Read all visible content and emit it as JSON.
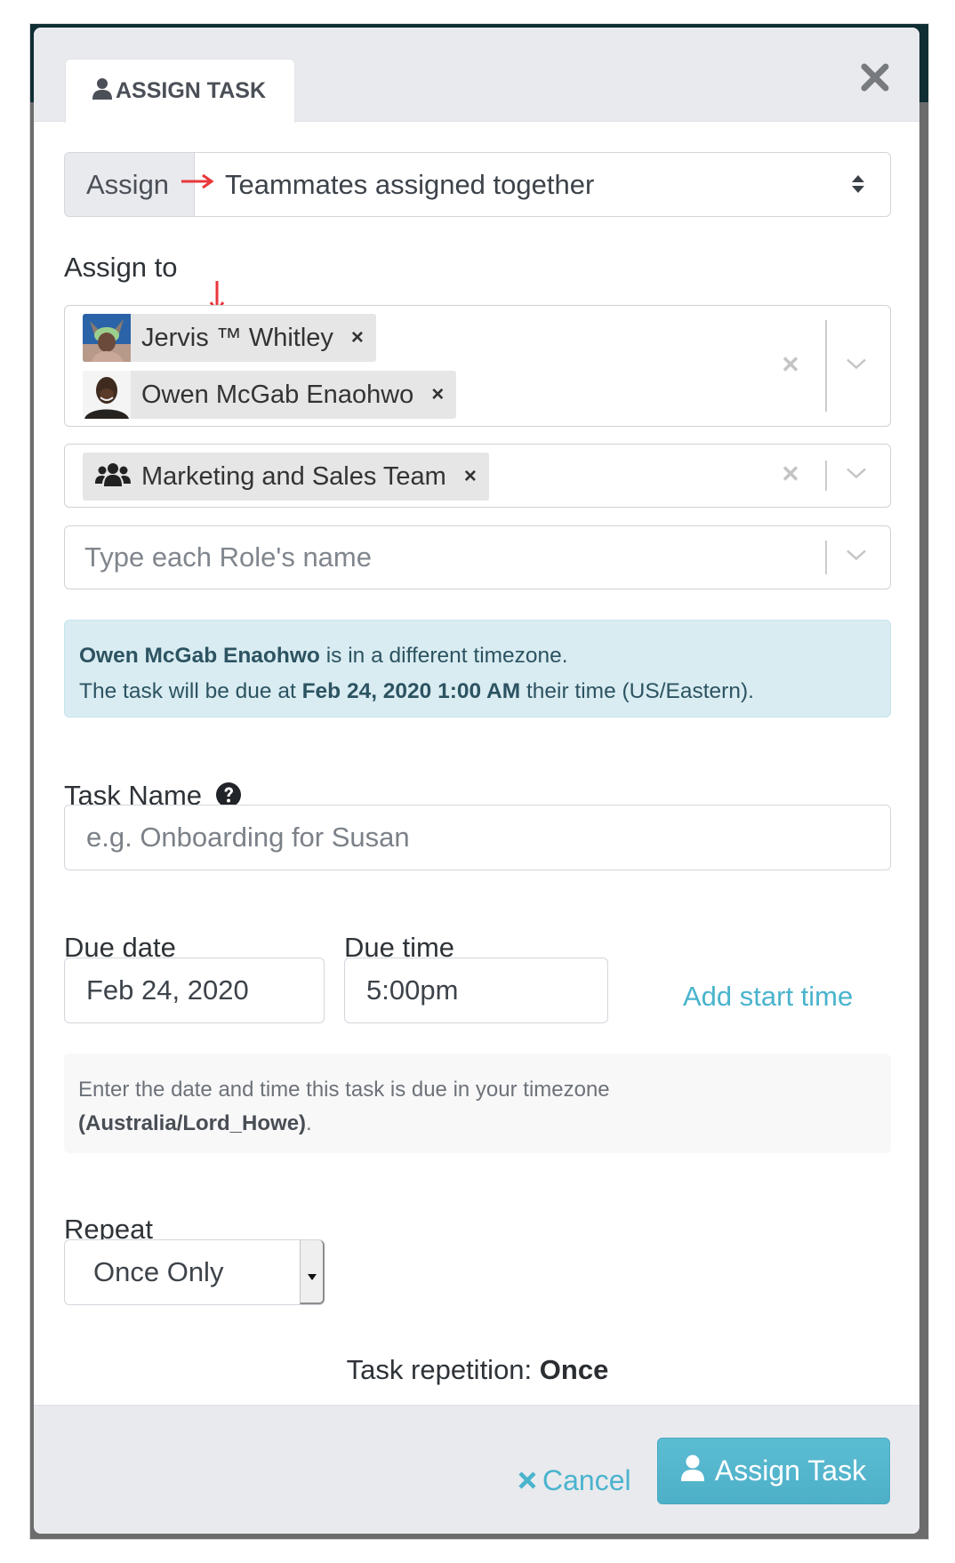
{
  "modal": {
    "tab_label": "ASSIGN TASK",
    "tab_icon": "user-icon",
    "close_icon": "close-icon"
  },
  "assign_mode": {
    "addon_label": "Assign",
    "selected": "Teammates assigned together",
    "annotation_color": "#e8373b"
  },
  "assign_to": {
    "label": "Assign to",
    "people": [
      {
        "name": "Jervis ™ Whitley",
        "remove": "×"
      },
      {
        "name": "Owen McGab Enaohwo",
        "remove": "×"
      }
    ],
    "teams": [
      {
        "name": "Marketing and Sales Team",
        "icon": "users-icon",
        "remove": "×"
      }
    ],
    "roles_placeholder": "Type each Role's name"
  },
  "timezone_alert": {
    "person": "Owen McGab Enaohwo",
    "line1_rest": " is in a different timezone.",
    "line2_prefix": "The task will be due at ",
    "due_local": "Feb 24, 2020 1:00 AM",
    "line2_suffix": " their time (US/Eastern)."
  },
  "task_name": {
    "label": "Task Name",
    "placeholder": "e.g. Onboarding for Susan",
    "value": ""
  },
  "due": {
    "date_label": "Due date",
    "time_label": "Due time",
    "date_value": "Feb 24, 2020",
    "time_value": "5:00pm",
    "add_start_link": "Add start time",
    "help_prefix": "Enter the date and time this task is due in your timezone",
    "help_timezone": "(Australia/Lord_Howe)",
    "help_suffix": "."
  },
  "repeat": {
    "label": "Repeat",
    "selected": "Once Only",
    "summary_prefix": "Task repetition: ",
    "summary_value": "Once"
  },
  "footer": {
    "cancel_label": "Cancel",
    "assign_label": "Assign Task"
  },
  "colors": {
    "accent": "#4ab4cd",
    "alert_bg": "#d9ecf2",
    "header_bg": "#e9eaee"
  }
}
